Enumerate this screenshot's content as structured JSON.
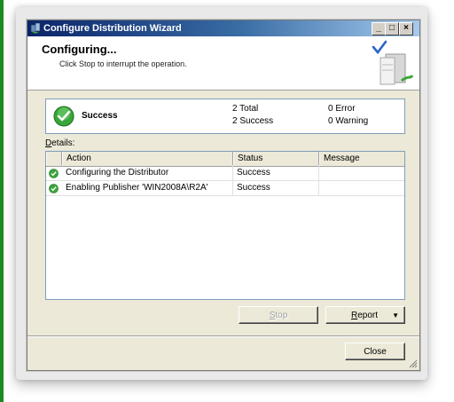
{
  "window": {
    "title": "Configure Distribution Wizard",
    "buttons": {
      "minimize": "_",
      "maximize": "□",
      "close": "×"
    }
  },
  "header": {
    "title": "Configuring...",
    "subtitle": "Click Stop to interrupt the operation."
  },
  "summary": {
    "result": "Success",
    "total": "2  Total",
    "success": "2  Success",
    "error": "0  Error",
    "warning": "0  Warning",
    "icon": "success-check-icon"
  },
  "details": {
    "label_prefix": "D",
    "label_rest": "etails:",
    "columns": [
      "Action",
      "Status",
      "Message"
    ],
    "rows": [
      {
        "action": "Configuring the Distributor",
        "status": "Success",
        "message": ""
      },
      {
        "action": "Enabling Publisher 'WIN2008A\\R2A'",
        "status": "Success",
        "message": ""
      }
    ]
  },
  "buttons": {
    "stop": {
      "prefix": "S",
      "rest": "top"
    },
    "report": {
      "prefix": "R",
      "rest": "eport"
    },
    "close": "Close"
  },
  "colors": {
    "success_green": "#3aa63a",
    "title_bar": "#0a246a",
    "dialog_bg": "#ece9d8"
  }
}
